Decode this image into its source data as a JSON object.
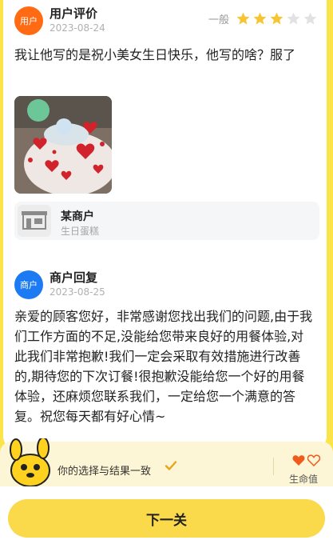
{
  "review": {
    "avatar_label": "用户",
    "title": "用户评价",
    "date": "2023-08-24",
    "rating_label": "一般",
    "rating": 3,
    "rating_max": 5,
    "text": "我让他写的是祝小美女生日快乐，他写的啥？服了"
  },
  "shop": {
    "name": "某商户",
    "category": "生日蛋糕"
  },
  "reply": {
    "avatar_label": "商户",
    "title": "商户回复",
    "date": "2023-08-25",
    "text": "亲爱的顾客您好，非常感谢您找出我们的问题,由于我们工作方面的不足,没能给您带来良好的用餐体验,对此我们非常抱歉!我们一定会采取有效措施进行改善的,期待您的下次订餐!很抱歉没能给您一个好的用餐体验，还麻烦您联系我们，一定给您一个满意的答复。祝您每天都有好心情~"
  },
  "status": {
    "message": "你的选择与结果一致",
    "lives_label": "生命值",
    "lives": 1,
    "lives_max": 2
  },
  "actions": {
    "next_label": "下一关"
  },
  "colors": {
    "accent_yellow": "#fad94b",
    "star_filled": "#f7c533",
    "star_empty": "#e2e2e2",
    "user_avatar": "#ff6a13",
    "merchant_avatar": "#1c7bf2",
    "heart": "#f05a1a"
  }
}
